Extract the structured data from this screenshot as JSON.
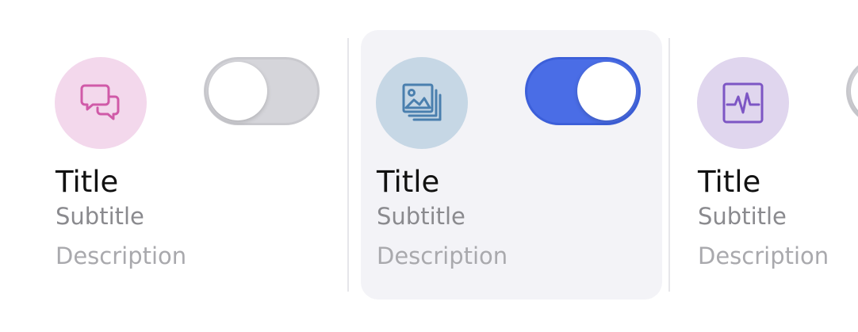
{
  "cards": [
    {
      "title": "Title",
      "subtitle": "Subtitle",
      "description": "Description",
      "icon": "chat-bubbles-icon",
      "icon_color": "#d05aa8",
      "icon_bg": "#f3d8ec",
      "toggle_on": false,
      "selected": false
    },
    {
      "title": "Title",
      "subtitle": "Subtitle",
      "description": "Description",
      "icon": "photo-stack-icon",
      "icon_color": "#4a7fae",
      "icon_bg": "#c6d7e5",
      "toggle_on": true,
      "selected": true
    },
    {
      "title": "Title",
      "subtitle": "Subtitle",
      "description": "Description",
      "icon": "activity-monitor-icon",
      "icon_color": "#7d56c4",
      "icon_bg": "#e0d6ee",
      "toggle_on": false,
      "selected": false
    }
  ],
  "colors": {
    "toggle_on": "#4a6de6",
    "toggle_off": "#d5d5da",
    "selected_card_bg": "#f3f3f7"
  }
}
